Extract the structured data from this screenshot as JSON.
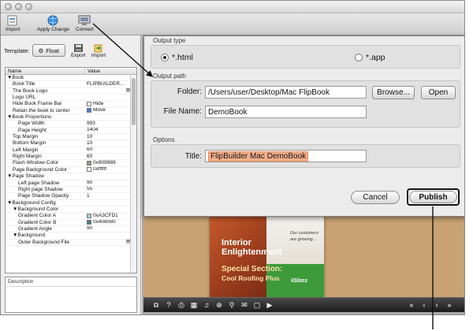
{
  "toolbar": {
    "items": [
      {
        "label": "Import",
        "icon": "import-icon"
      },
      {
        "label": "Apply Change",
        "icon": "globe-icon"
      },
      {
        "label": "Convert",
        "icon": "monitor-icon"
      }
    ]
  },
  "template_bar": {
    "label": "Template:",
    "button_label": "Float",
    "export_label": "Export",
    "import_label": "Import"
  },
  "properties": {
    "col_name": "Name",
    "col_value": "Value",
    "rows": [
      {
        "name": "▼Book",
        "value": "",
        "indent": 0
      },
      {
        "name": "Book Title",
        "value": "FLIPBUILDER...",
        "indent": 1
      },
      {
        "name": "The Book Logo",
        "value": "",
        "indent": 1,
        "extra": "▤"
      },
      {
        "name": "Logo URL",
        "value": "",
        "indent": 1
      },
      {
        "name": "Hide Book Frame Bar",
        "value": "Hide",
        "indent": 1,
        "check": false
      },
      {
        "name": "Retain the book to center",
        "value": "Move",
        "indent": 1,
        "check": true
      },
      {
        "name": "▼Book Proportions",
        "value": "",
        "indent": 0
      },
      {
        "name": "Page Width",
        "value": "993",
        "indent": 2
      },
      {
        "name": "Page Height",
        "value": "1404",
        "indent": 2
      },
      {
        "name": "Top Margin",
        "value": "10",
        "indent": 1
      },
      {
        "name": "Bottom Margin",
        "value": "10",
        "indent": 1
      },
      {
        "name": "Left Margin",
        "value": "60",
        "indent": 1
      },
      {
        "name": "Right Margin",
        "value": "60",
        "indent": 1
      },
      {
        "name": "Flash Window Color",
        "value": "0x909989",
        "indent": 1,
        "swatch": "#909989"
      },
      {
        "name": "Page Background Color",
        "value": "0xffffff",
        "indent": 1,
        "swatch": "#ffffff"
      },
      {
        "name": "▼Page Shadow",
        "value": "",
        "indent": 0
      },
      {
        "name": "Left page Shadow",
        "value": "90",
        "indent": 2
      },
      {
        "name": "Right page Shadow",
        "value": "55",
        "indent": 2
      },
      {
        "name": "Page Shadow Opacity",
        "value": "1",
        "indent": 2
      },
      {
        "name": "▼Background Config",
        "value": "",
        "indent": 0
      },
      {
        "name": "▼Background Color",
        "value": "",
        "indent": 1
      },
      {
        "name": "Gradient Color A",
        "value": "0xA3CFD1",
        "indent": 2,
        "swatch": "#A3CFD1"
      },
      {
        "name": "Gradient Color B",
        "value": "0x408080",
        "indent": 2,
        "swatch": "#408080"
      },
      {
        "name": "Gradient Angle",
        "value": "90",
        "indent": 2
      },
      {
        "name": "▼Background",
        "value": "",
        "indent": 1
      },
      {
        "name": "Outer Background File",
        "value": "",
        "indent": 2,
        "extra": "▤"
      }
    ],
    "description_label": "Description"
  },
  "dialog": {
    "output_type_title": "Output type",
    "opt_html": "*.html",
    "opt_app": "*.app",
    "output_path_title": "Output path",
    "folder_label": "Folder:",
    "folder_value": "/Users/user/Desktop/Mac FlipBook",
    "browse_label": "Browse...",
    "open_label": "Open",
    "filename_label": "File Name:",
    "filename_value": "DemoBook",
    "options_title": "Options",
    "title_label": "Title:",
    "title_value": "FlipBuilder Mac DemoBook",
    "cancel_label": "Cancel",
    "publish_label": "Publish"
  },
  "book": {
    "heading1": "Interior",
    "heading2": "Enlightenment",
    "special1": "Special Section:",
    "special2": "Cool Roofing Plus",
    "right1": "Our customers",
    "right2": "are growing...",
    "right3": "",
    "right4": "",
    "brand": "iGlass"
  },
  "colors": {
    "accent": "#4a7bd0",
    "viewer_bg": "#c9a273",
    "title_highlight": "#f5b08a"
  }
}
